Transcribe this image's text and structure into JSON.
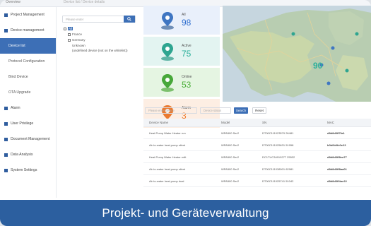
{
  "topbar": {
    "left": "Overview",
    "right": "Device list / Device details"
  },
  "sidebar": {
    "items": [
      {
        "label": "Project Management",
        "sub": false,
        "active": false
      },
      {
        "label": "Device management",
        "sub": false,
        "active": false
      },
      {
        "label": "Device list",
        "sub": true,
        "active": true
      },
      {
        "label": "Protocol Configuration",
        "sub": true,
        "active": false
      },
      {
        "label": "Bind Device",
        "sub": true,
        "active": false
      },
      {
        "label": "OTA Upgrade",
        "sub": true,
        "active": false
      },
      {
        "label": "Alarm",
        "sub": false,
        "active": false
      },
      {
        "label": "User Privilege",
        "sub": false,
        "active": false
      },
      {
        "label": "Document Management",
        "sub": false,
        "active": false
      },
      {
        "label": "Data Analysis",
        "sub": false,
        "active": false
      },
      {
        "label": "System Settings",
        "sub": false,
        "active": false
      }
    ]
  },
  "tree": {
    "search_placeholder": "Please enter",
    "nodes": [
      {
        "label": "All",
        "level": 0,
        "selected": true
      },
      {
        "label": "France",
        "level": 1,
        "selected": false
      },
      {
        "label": "Germany",
        "level": 1,
        "selected": false
      },
      {
        "label": "Unknown",
        "level": 1,
        "selected": false
      },
      {
        "label": "(undefined device (not on the whitelist))",
        "level": 1,
        "selected": false
      }
    ]
  },
  "stats": {
    "all": {
      "label": "All",
      "value": "98"
    },
    "active": {
      "label": "Active",
      "value": "75"
    },
    "online": {
      "label": "Online",
      "value": "53"
    },
    "alarm": {
      "label": "Alarm",
      "value": "3"
    }
  },
  "map": {
    "cluster_label": "90"
  },
  "filter": {
    "device_placeholder": "Please enter device",
    "status_placeholder": "Device status",
    "search_label": "Search",
    "reset_label": "Reset"
  },
  "table": {
    "headers": [
      "Device Name",
      "Model",
      "SN",
      "MAC"
    ],
    "rows": [
      [
        "Heat Pump Water Heater run",
        "WPA500 Ser2",
        "DT00C111023579 26481",
        "d8d8d3ff7fa1"
      ],
      [
        "Air-to-water heat pump silent",
        "WPA500 Ser2",
        "DT00C111025631 51958",
        "b0b0b0fe0e23"
      ],
      [
        "Heat Pump Water Heater edit",
        "WPA500 Ser2",
        "DC1TUC34910277 25532",
        "d8d8d3ff8ea77"
      ],
      [
        "Air-to-water heat pump silent",
        "WPA500 Ser2",
        "DT00C111038001 62981",
        "d8d8d3ff8aa01"
      ],
      [
        "Air-to-water heat pump dual",
        "WPA500 Ser2",
        "DT00C111025741 51042",
        "d8d8d3ff4ae22"
      ]
    ]
  },
  "banner": {
    "text": "Projekt- und Geräteverwaltung"
  },
  "colors": {
    "accent": "#3d6fb6",
    "banner": "#2c5f9f",
    "all": "#2f6fcf",
    "active": "#2aaf9a",
    "online": "#4caf3b",
    "alarm": "#ef7d2f"
  }
}
